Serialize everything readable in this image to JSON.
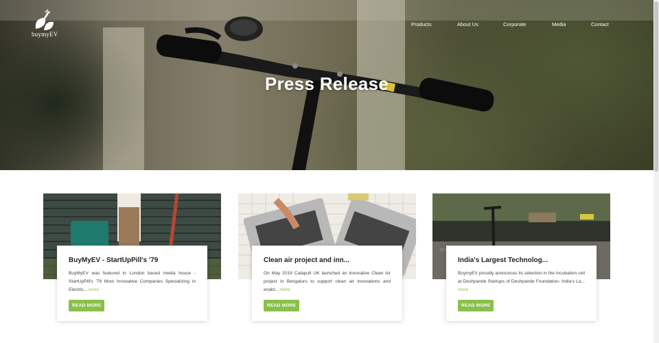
{
  "brand": {
    "name": "buymyEV"
  },
  "nav": {
    "items": [
      {
        "label": "Products"
      },
      {
        "label": "About Us"
      },
      {
        "label": "Corporate"
      },
      {
        "label": "Media"
      },
      {
        "label": "Contact"
      }
    ]
  },
  "hero": {
    "title": "Press Release"
  },
  "cards": [
    {
      "title": "BuyMyEV - StartUpPill's '79",
      "excerpt": "BuyMyEV was featured in London based media house - StartUpPill's '79 Most Innovative Companies Specializing in Electric...",
      "more": "more",
      "button": "READ MORE"
    },
    {
      "title": "Clean air project and inn...",
      "excerpt": "On May 2019 Catapult UK launched an innovative Clean Air project in Bengaluru to support clean air innovations and enabl...",
      "more": "more",
      "button": "READ MORE"
    },
    {
      "title": "India's Largest Technolog...",
      "excerpt": "BuymyEV proudly announces its selection in the Incubation cell at Deshpande Startups of Deshpande Foundation- India's La...",
      "more": "more",
      "button": "READ MORE"
    }
  ],
  "colors": {
    "accent": "#8ac04a",
    "hero_text": "#ffffff"
  }
}
